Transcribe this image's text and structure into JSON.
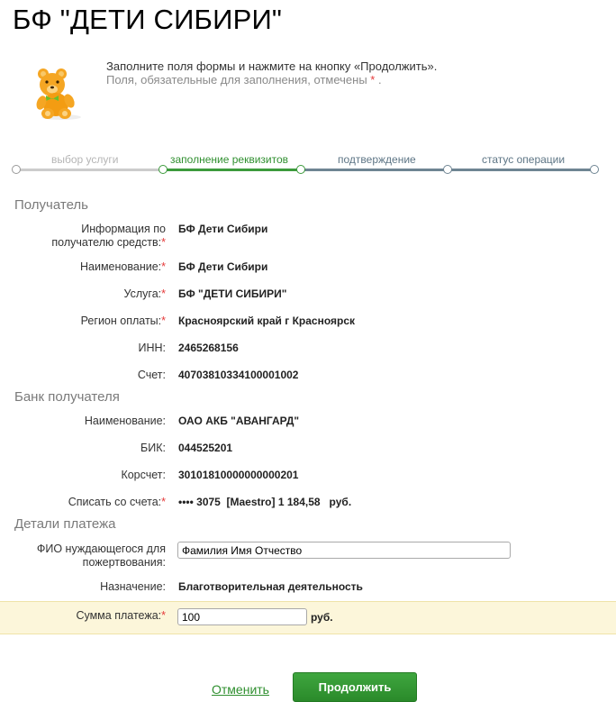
{
  "page": {
    "title": "БФ \"ДЕТИ СИБИРИ\""
  },
  "intro": {
    "line1": "Заполните поля формы и нажмите на кнопку «Продолжить».",
    "line2": "Поля, обязательные для заполнения, отмечены",
    "line2_star": "*",
    "line2_end": " ."
  },
  "steps": [
    {
      "label": "выбор услуги",
      "state": "done"
    },
    {
      "label": "заполнение реквизитов",
      "state": "active"
    },
    {
      "label": "подтверждение",
      "state": "next"
    },
    {
      "label": "статус операции",
      "state": "next"
    }
  ],
  "sections": {
    "recipient": "Получатель",
    "bank": "Банк получателя",
    "payment": "Детали платежа"
  },
  "recipient": {
    "info_label_1": "Информация по",
    "info_label_2": "получателю средств:",
    "info_value": "БФ Дети Сибири",
    "name_label": "Наименование:",
    "name_value": "БФ Дети Сибири",
    "service_label": "Услуга:",
    "service_value": "БФ \"ДЕТИ СИБИРИ\"",
    "region_label": "Регион оплаты:",
    "region_value": "Красноярский край г Красноярск",
    "inn_label": "ИНН:",
    "inn_value": "2465268156",
    "account_label": "Счет:",
    "account_value": "40703810334100001002"
  },
  "bank": {
    "name_label": "Наименование:",
    "name_value": "ОАО АКБ \"АВАНГАРД\"",
    "bik_label": "БИК:",
    "bik_value": "044525201",
    "corr_label": "Корсчет:",
    "corr_value": "30101810000000000201",
    "debit_label": "Списать со счета:",
    "debit_value": "•••• 3075  [Maestro] 1 184,58   руб."
  },
  "payment": {
    "fio_label_1": "ФИО нуждающегося для",
    "fio_label_2": "пожертвования:",
    "fio_value": "Фамилия Имя Отчество",
    "purpose_label": "Назначение:",
    "purpose_value": "Благотворительная деятельность",
    "amount_label": "Сумма платежа:",
    "amount_value": "100",
    "currency": "руб."
  },
  "required_mark": "*",
  "buttons": {
    "cancel": "Отменить",
    "continue": "Продолжить"
  },
  "colors": {
    "accent": "#2f8f2f",
    "progress_done": "#c8c8c8",
    "progress_next": "#6f8593",
    "required": "#e53b3b",
    "sum_band": "#fcf6da"
  }
}
